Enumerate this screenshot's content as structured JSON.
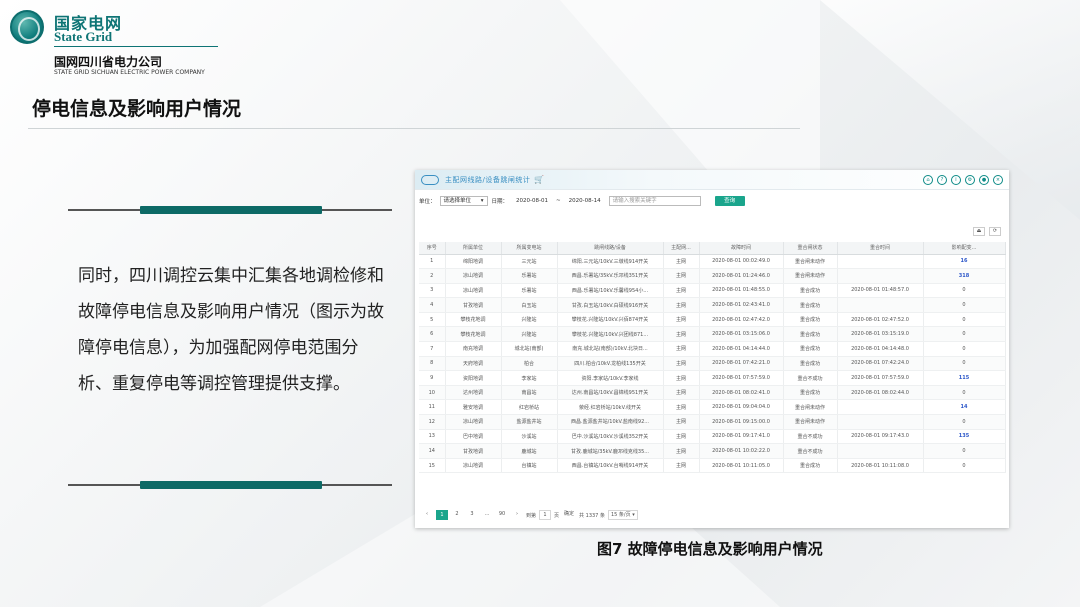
{
  "logo": {
    "cn": "国家电网",
    "en": "State Grid",
    "sub_cn": "国网四川省电力公司",
    "sub_en": "STATE GRID SICHUAN ELECTRIC POWER COMPANY"
  },
  "title": "停电信息及影响用户情况",
  "body_text": "同时，四川调控云集中汇集各地调检修和故障停电信息及影响用户情况（图示为故障停电信息），为加强配网停电范围分析、重复停电等调控管理提供支撑。",
  "caption": "图7 故障停电信息及影响用户情况",
  "app": {
    "title": "主配网线路/设备跳闸统计",
    "header_icons": [
      "home-icon",
      "help-icon",
      "info-icon",
      "settings-icon",
      "user-icon",
      "close-icon"
    ],
    "filter": {
      "unit_label": "单位：",
      "unit_value": "请选择单位",
      "date_label": "日期：",
      "date_from": "2020-08-01",
      "date_sep": "~",
      "date_to": "2020-08-14",
      "search_placeholder": "请输入搜索关键字",
      "query_button": "查询"
    },
    "columns": [
      "序号",
      "所属单位",
      "所属变电站",
      "跳闸线路/设备",
      "主配网...",
      "故障时间",
      "重合闸状态",
      "重合时间",
      "影响配变..."
    ],
    "rows": [
      [
        "1",
        "绵阳地调",
        "三元站",
        "绵阳.三元站/10kV.三墩线914开关",
        "主网",
        "2020-08-01 00:02:49.0",
        "重合闸未动作",
        "",
        "16"
      ],
      [
        "2",
        "凉山地调",
        "乐署站",
        "西昌.乐署站/35kV.乐邛线351开关",
        "主网",
        "2020-08-01 01:24:46.0",
        "重合闸未动作",
        "",
        "318"
      ],
      [
        "3",
        "凉山地调",
        "乐署站",
        "西昌.乐署站/10kV.乐馨线954小...",
        "主网",
        "2020-08-01 01:48:55.0",
        "重合成功",
        "2020-08-01 01:48:57.0",
        "0"
      ],
      [
        "4",
        "甘孜地调",
        "白玉站",
        "甘孜.白玉站/10kV.白硕线916开关",
        "主网",
        "2020-08-01 02:43:41.0",
        "重合成功",
        "",
        "0"
      ],
      [
        "5",
        "攀枝花地调",
        "兴隆站",
        "攀枝花.兴隆站/10kV.兴佰874开关",
        "主网",
        "2020-08-01 02:47:42.0",
        "重合成功",
        "2020-08-01 02:47:52.0",
        "0"
      ],
      [
        "6",
        "攀枝花地调",
        "兴隆站",
        "攀枝花.兴隆站/10kV.兴团线871...",
        "主网",
        "2020-08-01 03:15:06.0",
        "重合成功",
        "2020-08-01 03:15:19.0",
        "0"
      ],
      [
        "7",
        "南充地调",
        "城北站(南部)",
        "南充.城北站(南部)/10kV.北块日...",
        "主网",
        "2020-08-01 04:14:44.0",
        "重合成功",
        "2020-08-01 04:14:48.0",
        "0"
      ],
      [
        "8",
        "天府地调",
        "柏合",
        "四川.柏合/10kV.龙柏线135开关",
        "主网",
        "2020-08-01 07:42:21.0",
        "重合成功",
        "2020-08-01 07:42:24.0",
        "0"
      ],
      [
        "9",
        "资阳地调",
        "李家站",
        "资阳.李家站/10kV.李家线",
        "主网",
        "2020-08-01 07:57:59.0",
        "重合不成功",
        "2020-08-01 07:57:59.0",
        "115"
      ],
      [
        "10",
        "达州地调",
        "南昌站",
        "达州.南昌站/10kV.昌锦线951开关",
        "主网",
        "2020-08-01 08:02:41.0",
        "重合成功",
        "2020-08-01 08:02:44.0",
        "0"
      ],
      [
        "11",
        "雅安地调",
        "红岩桥站",
        "荥经.红岩桥站/10kV.线开关",
        "主网",
        "2020-08-01 09:04:04.0",
        "重合闸未动作",
        "",
        "14"
      ],
      [
        "12",
        "凉山地调",
        "盐源盐井站",
        "西昌.盐源盐井站/10kV.盐南线92...",
        "主网",
        "2020-08-01 09:15:00.0",
        "重合闸未动作",
        "",
        "0"
      ],
      [
        "13",
        "巴中地调",
        "沙溪站",
        "巴中.沙溪站/10kV.沙溪线352开关",
        "主网",
        "2020-08-01 09:17:41.0",
        "重合不成功",
        "2020-08-01 09:17:43.0",
        "135"
      ],
      [
        "14",
        "甘孜地调",
        "鹿城站",
        "甘孜.鹿城站/35kV.鹿邛线克线35...",
        "主网",
        "2020-08-01 10:02:22.0",
        "重合不成功",
        "",
        "0"
      ],
      [
        "15",
        "凉山地调",
        "台镇站",
        "西昌.台镇站/10kV.台哨线914开关",
        "主网",
        "2020-08-01 10:11:05.0",
        "重合成功",
        "2020-08-01 10:11:08.0",
        "0"
      ]
    ],
    "pager": {
      "prev": "‹",
      "pages": [
        "1",
        "2",
        "3",
        "...",
        "90"
      ],
      "next": "›",
      "goto_label": "到第",
      "goto_value": "1",
      "page_unit": "页",
      "confirm": "确定",
      "total": "共 1337 条",
      "per_page": "15 条/页"
    }
  }
}
